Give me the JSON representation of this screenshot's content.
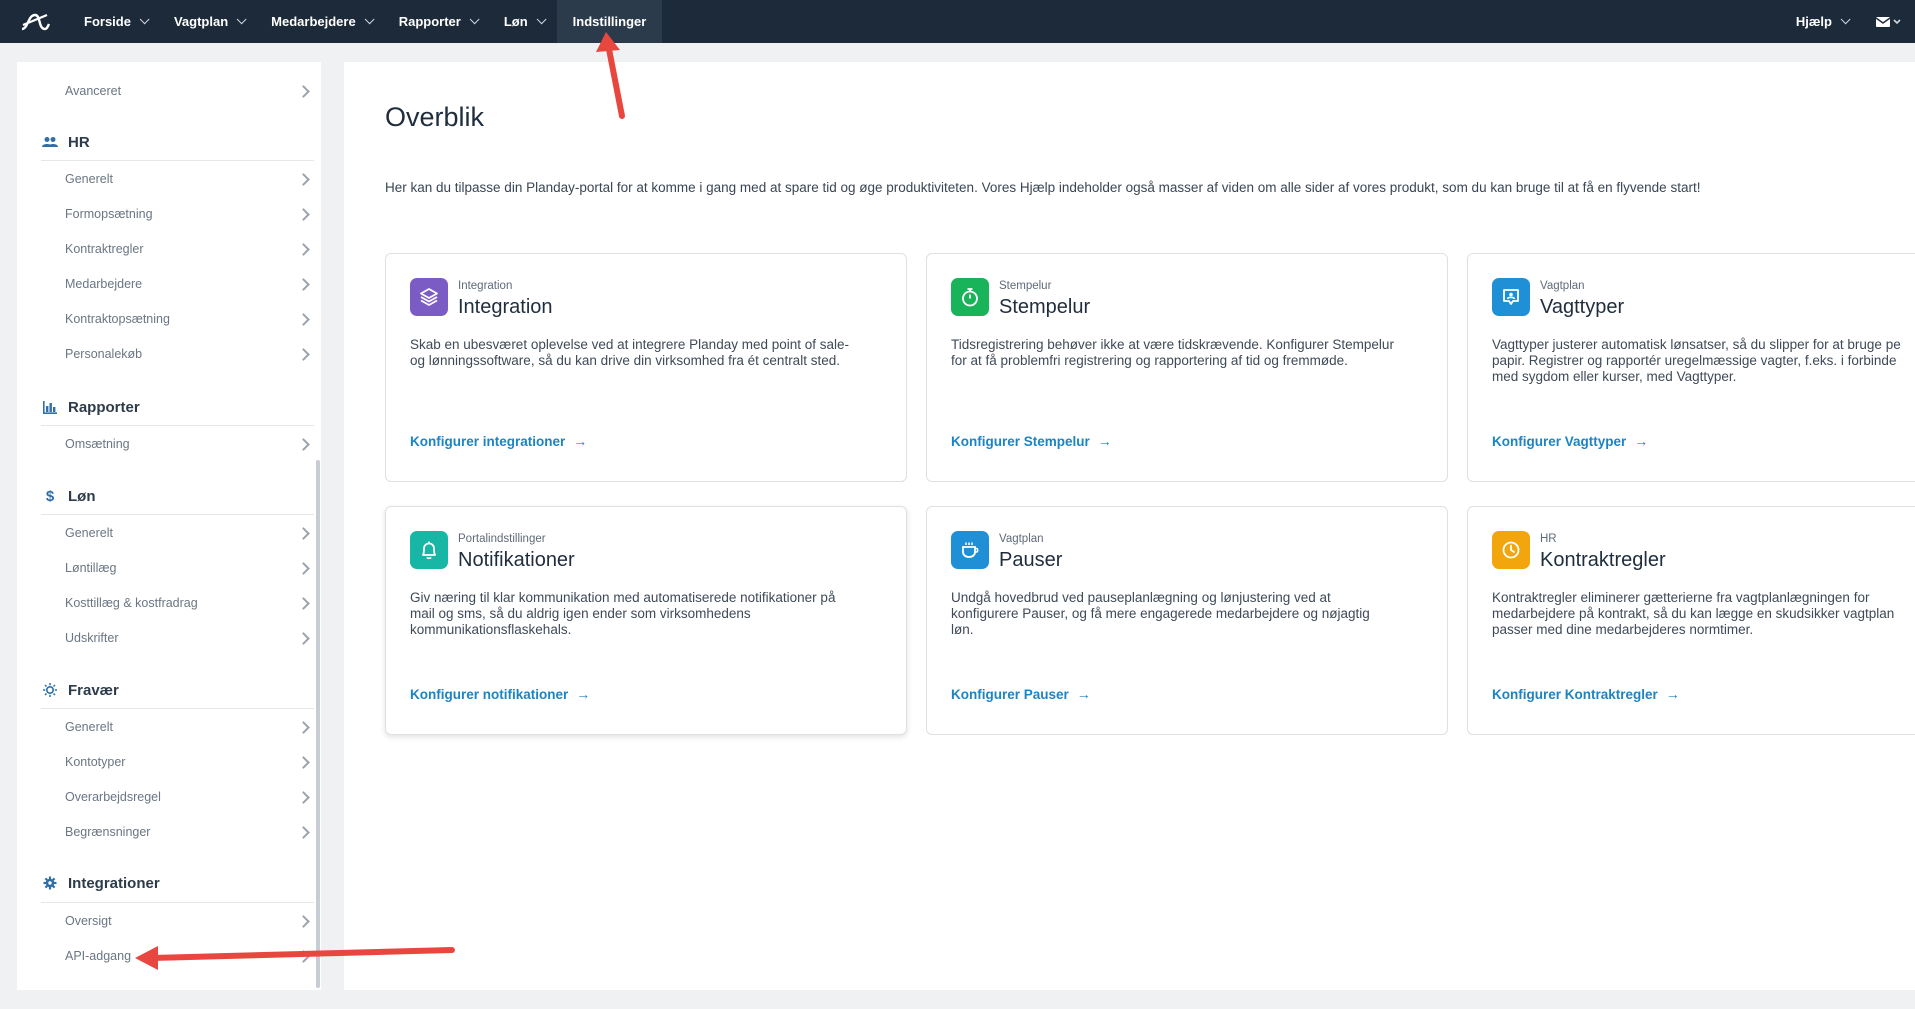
{
  "topnav": {
    "items": [
      {
        "label": "Forside",
        "chevron": true
      },
      {
        "label": "Vagtplan",
        "chevron": true
      },
      {
        "label": "Medarbejdere",
        "chevron": true
      },
      {
        "label": "Rapporter",
        "chevron": true
      },
      {
        "label": "Løn",
        "chevron": true
      },
      {
        "label": "Indstillinger",
        "chevron": false,
        "active": true
      }
    ],
    "help": "Hjælp"
  },
  "sidebar": {
    "top_item": "Avanceret",
    "sections": [
      {
        "title": "HR",
        "icon": "people-icon",
        "items": [
          "Generelt",
          "Formopsætning",
          "Kontraktregler",
          "Medarbejdere",
          "Kontraktopsætning",
          "Personalekøb"
        ]
      },
      {
        "title": "Rapporter",
        "icon": "bar-chart-icon",
        "items": [
          "Omsætning"
        ]
      },
      {
        "title": "Løn",
        "icon": "dollar-icon",
        "items": [
          "Generelt",
          "Løntillæg",
          "Kosttillæg & kostfradrag",
          "Udskrifter"
        ]
      },
      {
        "title": "Fravær",
        "icon": "sun-icon",
        "items": [
          "Generelt",
          "Kontotyper",
          "Overarbejdsregel",
          "Begrænsninger"
        ]
      },
      {
        "title": "Integrationer",
        "icon": "gear-icon",
        "items": [
          "Oversigt",
          "API-adgang"
        ]
      }
    ]
  },
  "main": {
    "title": "Overblik",
    "intro": "Her kan du tilpasse din Planday-portal for at komme i gang med at spare tid og øge produktiviteten. Vores Hjælp indeholder også masser af viden om alle sider af vores produkt, som du kan bruge til at få en flyvende start!",
    "cards": [
      {
        "category": "Integration",
        "title": "Integration",
        "icon": "layers-icon",
        "color": "#7b5cc4",
        "desc": "Skab en ubesværet oplevelse ved at integrere Planday med point of sale-\nog lønningssoftware, så du kan drive din virksomhed fra ét centralt sted.",
        "link": "Konfigurer integrationer"
      },
      {
        "category": "Stempelur",
        "title": "Stempelur",
        "icon": "stopwatch-icon",
        "color": "#19b35a",
        "desc": "Tidsregistrering behøver ikke at være tidskrævende. Konfigurer Stempelur\nfor at få problemfri registrering og rapportering af tid og fremmøde.",
        "link": "Konfigurer Stempelur"
      },
      {
        "category": "Vagtplan",
        "title": "Vagttyper",
        "icon": "shift-badge-icon",
        "color": "#1f8fd6",
        "desc": "Vagttyper justerer automatisk lønsatser, så du slipper for at bruge pe\npapir. Registrer og rapportér uregelmæssige vagter, f.eks. i forbinde\nmed sygdom eller kurser, med Vagttyper.",
        "link": "Konfigurer Vagttyper"
      },
      {
        "category": "Portalindstillinger",
        "title": "Notifikationer",
        "icon": "bell-icon",
        "color": "#18b6a4",
        "desc": "Giv næring til klar kommunikation med automatiserede notifikationer på\nmail og sms, så du aldrig igen ender som virksomhedens\nkommunikationsflaskehals.",
        "link": "Konfigurer notifikationer"
      },
      {
        "category": "Vagtplan",
        "title": "Pauser",
        "icon": "coffee-icon",
        "color": "#1f8fd6",
        "desc": "Undgå hovedbrud ved pauseplanlægning og lønjustering ved at\nkonfigurere Pauser, og få mere engagerede medarbejdere og nøjagtig\nløn.",
        "link": "Konfigurer Pauser"
      },
      {
        "category": "HR",
        "title": "Kontraktregler",
        "icon": "clock-icon",
        "color": "#f2a50c",
        "desc": "Kontraktregler eliminerer gætterierne fra vagtplanlægningen for\nmedarbejdere på kontrakt, så du kan lægge en skudsikker vagtplan\npasser med dine medarbejderes normtimer.",
        "link": "Konfigurer Kontraktregler"
      }
    ]
  },
  "colors": {
    "nav_bg": "#1c2a3a",
    "link": "#1b84c4",
    "annotation": "#e8473f"
  }
}
